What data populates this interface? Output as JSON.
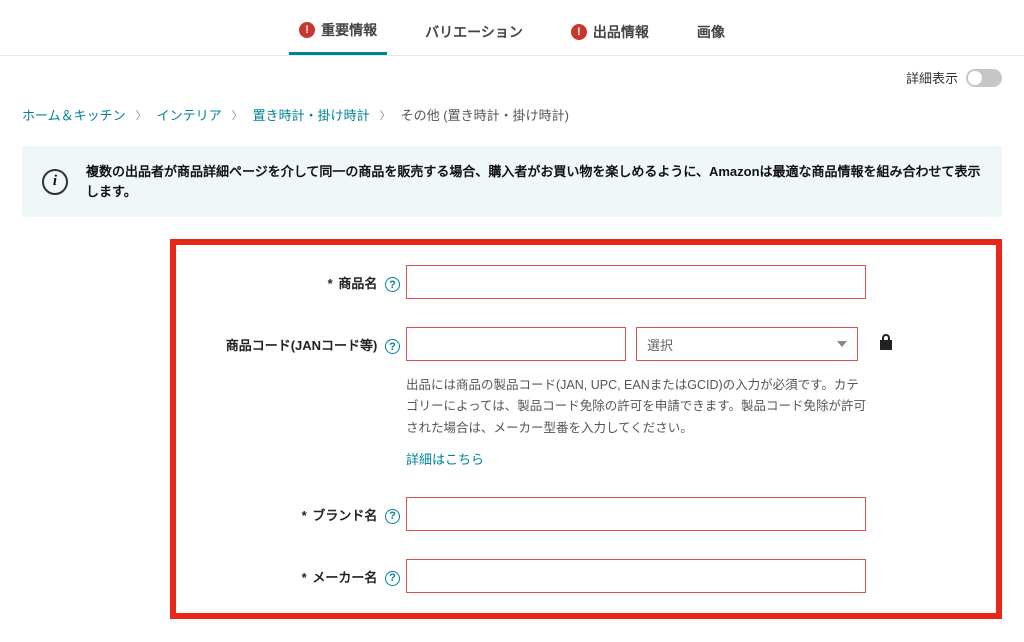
{
  "tabs": [
    {
      "label": "重要情報",
      "alert": true,
      "active": true
    },
    {
      "label": "バリエーション",
      "alert": false,
      "active": false
    },
    {
      "label": "出品情報",
      "alert": true,
      "active": false
    },
    {
      "label": "画像",
      "alert": false,
      "active": false
    }
  ],
  "detail_toggle": {
    "label": "詳細表示"
  },
  "breadcrumb": {
    "items": [
      {
        "label": "ホーム＆キッチン",
        "link": true
      },
      {
        "label": "インテリア",
        "link": true
      },
      {
        "label": "置き時計・掛け時計",
        "link": true
      },
      {
        "label": "その他 (置き時計・掛け時計)",
        "link": false
      }
    ]
  },
  "info_banner": {
    "text": "複数の出品者が商品詳細ページを介して同一の商品を販売する場合、購入者がお買い物を楽しめるように、Amazonは最適な商品情報を組み合わせて表示します。"
  },
  "form": {
    "product_name": {
      "label": "商品名",
      "required": true,
      "value": ""
    },
    "product_code": {
      "label": "商品コード(JANコード等)",
      "required": false,
      "value": "",
      "select_placeholder": "選択",
      "hint": "出品には商品の製品コード(JAN, UPC, EANまたはGCID)の入力が必須です。カテゴリーによっては、製品コード免除の許可を申請できます。製品コード免除が許可された場合は、メーカー型番を入力してください。",
      "more_link": "詳細はこちら"
    },
    "brand_name": {
      "label": "ブランド名",
      "required": true,
      "value": ""
    },
    "maker_name": {
      "label": "メーカー名",
      "required": true,
      "value": ""
    }
  }
}
